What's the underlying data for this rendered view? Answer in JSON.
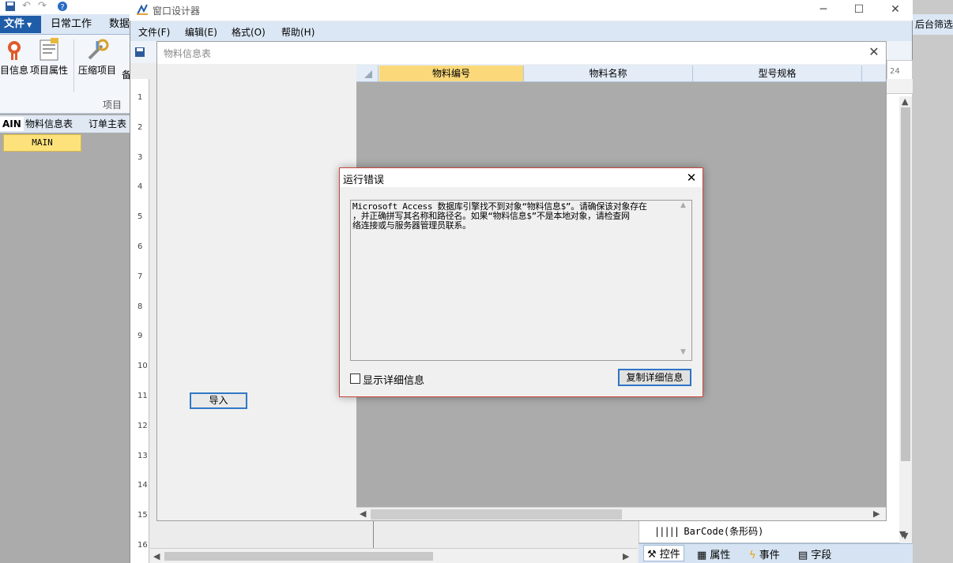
{
  "app": {
    "file_tab": "文件",
    "tabs": [
      "日常工作",
      "数据"
    ],
    "ribbon_buttons": [
      "目信息",
      "项目属性",
      "压缩项目",
      "备"
    ],
    "group_label": "项目",
    "doc_tabs": [
      "AIN",
      "物料信息表",
      "订单主表"
    ],
    "main_cell": "MAIN",
    "right_label": "后台筛选"
  },
  "designer": {
    "title": "窗口设计器",
    "menu": [
      "文件(F)",
      "编辑(E)",
      "格式(O)",
      "帮助(H)"
    ],
    "ruler_numbers": [
      "1",
      "2",
      "3",
      "4",
      "5",
      "6",
      "7",
      "8",
      "9",
      "10",
      "11",
      "12",
      "13",
      "14",
      "15",
      "16"
    ],
    "ruler_top_value": "24",
    "pin_glyph": "╤",
    "barcode_item": "BarCode(条形码)",
    "bottom_tabs": [
      "控件",
      "属性",
      "事件",
      "字段"
    ],
    "colors": {
      "menu_bg": "#dbe7f5",
      "accent": "#1f5da8"
    }
  },
  "form": {
    "title": "物料信息表",
    "import_button": "导入",
    "columns": [
      "物料编号",
      "物料名称",
      "型号规格"
    ],
    "active_column_color": "#fbd97a"
  },
  "dialog": {
    "title": "运行错误",
    "message_lines": [
      "Microsoft Access 数据库引擎找不到对象“物料信息$”。请确保该对象存在",
      "，并正确拼写其名称和路径名。如果“物料信息$”不是本地对象，请检查网",
      "络连接或与服务器管理员联系。"
    ],
    "checkbox_label": "显示详细信息",
    "checkbox_checked": false,
    "copy_button": "复制详细信息"
  }
}
